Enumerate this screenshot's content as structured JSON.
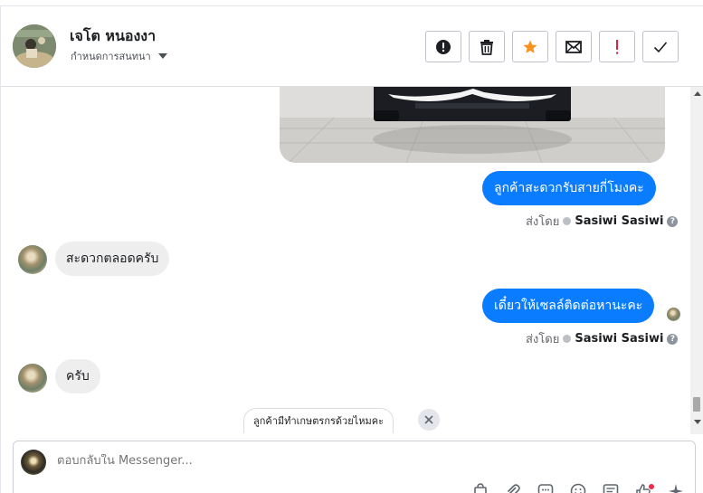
{
  "header": {
    "contact_name": "เจโต หนองงา",
    "assign_label": "กำหนดการสนทนา",
    "actions": [
      {
        "name": "mark-spam",
        "icon": "alert-circle-icon"
      },
      {
        "name": "delete",
        "icon": "trash-icon"
      },
      {
        "name": "star",
        "icon": "star-icon"
      },
      {
        "name": "mark-unread",
        "icon": "envelope-icon"
      },
      {
        "name": "follow-up",
        "icon": "exclamation-icon"
      },
      {
        "name": "mark-done",
        "icon": "checkmark-icon"
      }
    ]
  },
  "messages": [
    {
      "direction": "out",
      "type": "image",
      "icon": "car-photo"
    },
    {
      "direction": "out",
      "text": "ลูกค้าสะดวกรับสายกี่โมงคะ",
      "sent_prefix": "ส่งโดย",
      "sender": "Sasiwi Sasiwi"
    },
    {
      "direction": "in",
      "text": "สะดวกตลอดครับ"
    },
    {
      "direction": "out",
      "text": "เดี๋ยวให้เซลล์ติดต่อหานะคะ",
      "sent_prefix": "ส่งโดย",
      "sender": "Sasiwi Sasiwi"
    },
    {
      "direction": "in",
      "text": "ครับ"
    }
  ],
  "quick_reply": {
    "text": "ลูกค้ามีทำเกษตรกรด้วยไหมคะ"
  },
  "composer": {
    "placeholder": "ตอบกลับใน Messenger..."
  },
  "colors": {
    "accent": "#0a7cff",
    "star": "#f7931e",
    "follow_up": "#e41e3f",
    "incoming_bubble": "#eeeeef"
  }
}
